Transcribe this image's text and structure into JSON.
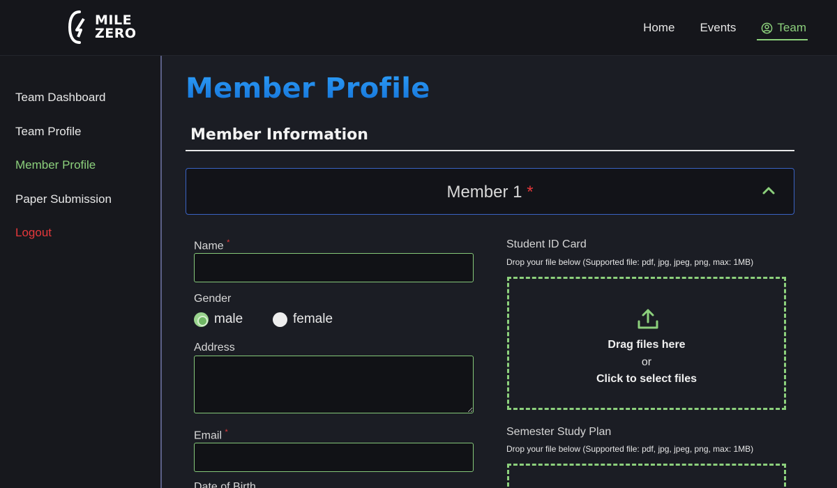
{
  "brand": {
    "logo_line1": "MILE",
    "logo_line2": "ZERO"
  },
  "nav": {
    "home": "Home",
    "events": "Events",
    "team": "Team"
  },
  "sidebar": {
    "items": [
      {
        "label": "Team Dashboard"
      },
      {
        "label": "Team Profile"
      },
      {
        "label": "Member Profile"
      },
      {
        "label": "Paper Submission"
      },
      {
        "label": "Logout"
      }
    ]
  },
  "page": {
    "title": "Member Profile",
    "section": "Member Information"
  },
  "accordion": {
    "title": "Member 1",
    "required_mark": "*"
  },
  "form": {
    "name_label": "Name",
    "required_mark": "*",
    "gender_label": "Gender",
    "gender_options": [
      "male",
      "female"
    ],
    "gender_selected": "male",
    "address_label": "Address",
    "email_label": "Email",
    "dob_label": "Date of Birth"
  },
  "uploads": {
    "student_id": {
      "label": "Student ID Card",
      "hint": "Drop your file below (Supported file: pdf, jpg, jpeg, png, max: 1MB)",
      "drag_text": "Drag files here",
      "or_text": "or",
      "click_text": "Click to select files"
    },
    "study_plan": {
      "label": "Semester Study Plan",
      "hint": "Drop your file below (Supported file: pdf, jpg, jpeg, png, max: 1MB)"
    }
  },
  "colors": {
    "accent_green": "#8cd07c",
    "title_blue": "#1d8cf0",
    "danger_red": "#e5383b",
    "background": "#1b1d24"
  },
  "icons": [
    "logo-icon",
    "user-circle-icon",
    "chevron-up-icon",
    "upload-icon"
  ]
}
